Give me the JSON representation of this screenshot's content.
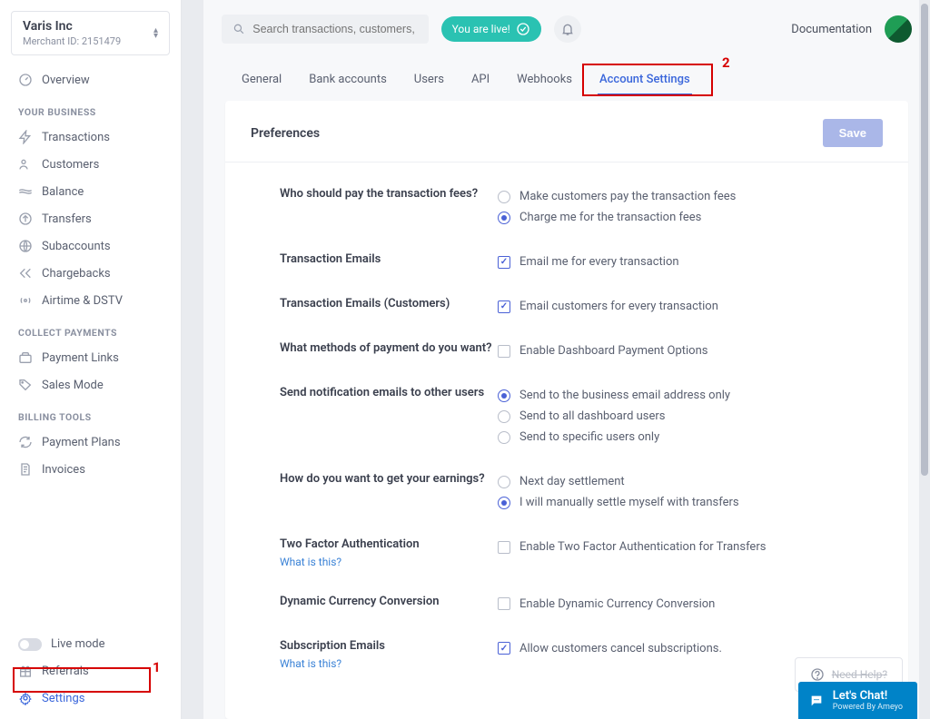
{
  "merchant": {
    "name": "Varis Inc",
    "id_label": "Merchant ID: 2151479"
  },
  "sidebar": {
    "overview": "Overview",
    "sections": {
      "business": "YOUR BUSINESS",
      "collect": "COLLECT PAYMENTS",
      "billing": "BILLING TOOLS"
    },
    "items": {
      "transactions": "Transactions",
      "customers": "Customers",
      "balance": "Balance",
      "transfers": "Transfers",
      "subaccounts": "Subaccounts",
      "chargebacks": "Chargebacks",
      "airtime": "Airtime & DSTV",
      "payment_links": "Payment Links",
      "sales_mode": "Sales Mode",
      "payment_plans": "Payment Plans",
      "invoices": "Invoices",
      "live_mode": "Live mode",
      "referrals": "Referrals",
      "settings": "Settings"
    }
  },
  "topbar": {
    "search_placeholder": "Search transactions, customers, and payment references.",
    "live_pill": "You are live!",
    "documentation": "Documentation"
  },
  "tabs": {
    "general": "General",
    "bank": "Bank accounts",
    "users": "Users",
    "api": "API",
    "webhooks": "Webhooks",
    "account_settings": "Account Settings"
  },
  "card": {
    "title": "Preferences",
    "save": "Save"
  },
  "prefs": {
    "fees_label": "Who should pay the transaction fees?",
    "fees_opt1": "Make customers pay the transaction fees",
    "fees_opt2": "Charge me for the transaction fees",
    "tx_emails_label": "Transaction Emails",
    "tx_emails_opt": "Email me for every transaction",
    "tx_emails_cust_label": "Transaction Emails (Customers)",
    "tx_emails_cust_opt": "Email customers for every transaction",
    "methods_label": "What methods of payment do you want?",
    "methods_opt": "Enable Dashboard Payment Options",
    "notif_label": "Send notification emails to other users",
    "notif_opt1": "Send to the business email address only",
    "notif_opt2": "Send to all dashboard users",
    "notif_opt3": "Send to specific users only",
    "earnings_label": "How do you want to get your earnings?",
    "earnings_opt1": "Next day settlement",
    "earnings_opt2": "I will manually settle myself with transfers",
    "twofa_label": "Two Factor Authentication",
    "twofa_help": "What is this?",
    "twofa_opt": "Enable Two Factor Authentication for Transfers",
    "dcc_label": "Dynamic Currency Conversion",
    "dcc_opt": "Enable Dynamic Currency Conversion",
    "sub_label": "Subscription Emails",
    "sub_help": "What is this?",
    "sub_opt": "Allow customers cancel subscriptions."
  },
  "annotations": {
    "num1": "1",
    "num2": "2"
  },
  "chat": {
    "title": "Let's Chat!",
    "sub": "Powered By Ameyo"
  },
  "help": {
    "text": "Need Help?"
  }
}
